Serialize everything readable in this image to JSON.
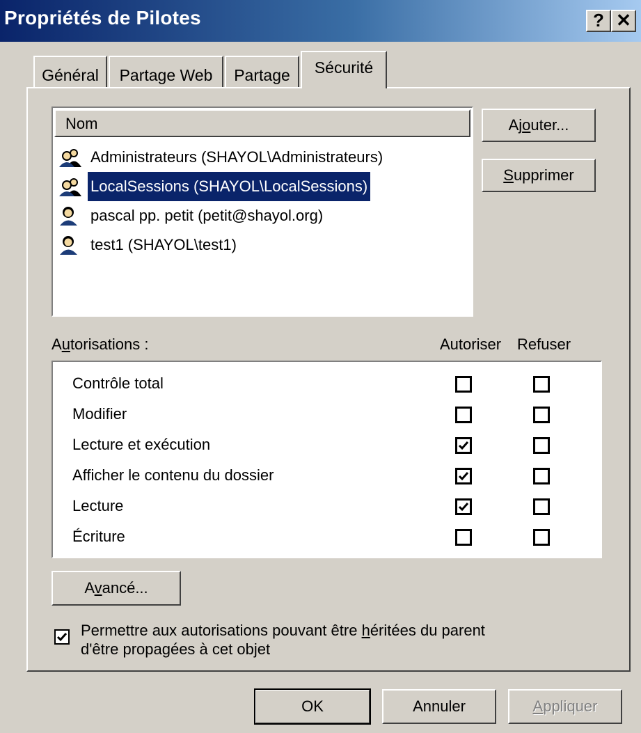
{
  "window": {
    "title": "Propriétés de Pilotes",
    "help_label": "?",
    "close_label": "✕"
  },
  "tabs": [
    {
      "label": "Général",
      "active": false
    },
    {
      "label": "Partage Web",
      "active": false
    },
    {
      "label": "Partage",
      "active": false
    },
    {
      "label": "Sécurité",
      "active": true
    }
  ],
  "users": {
    "column_header": "Nom",
    "items": [
      {
        "label": "Administrateurs (SHAYOL\\Administrateurs)",
        "icon": "group-users-icon",
        "selected": false
      },
      {
        "label": "LocalSessions (SHAYOL\\LocalSessions)",
        "icon": "group-users-icon",
        "selected": true
      },
      {
        "label": "pascal pp. petit (petit@shayol.org)",
        "icon": "user-icon",
        "selected": false
      },
      {
        "label": "test1 (SHAYOL\\test1)",
        "icon": "user-icon",
        "selected": false
      }
    ],
    "add_button": {
      "pre": "Aj",
      "accel": "o",
      "post": "uter..."
    },
    "remove_button": {
      "pre": "",
      "accel": "S",
      "post": "upprimer"
    }
  },
  "permissions": {
    "label": {
      "pre": "A",
      "accel": "u",
      "post": "torisations :"
    },
    "allow_header": "Autoriser",
    "deny_header": "Refuser",
    "rows": [
      {
        "name": "Contrôle total",
        "allow": false,
        "deny": false
      },
      {
        "name": "Modifier",
        "allow": false,
        "deny": false
      },
      {
        "name": "Lecture et exécution",
        "allow": true,
        "deny": false
      },
      {
        "name": "Afficher le contenu du dossier",
        "allow": true,
        "deny": false
      },
      {
        "name": "Lecture",
        "allow": true,
        "deny": false
      },
      {
        "name": "Écriture",
        "allow": false,
        "deny": false
      }
    ]
  },
  "advanced_button": {
    "pre": "A",
    "accel": "v",
    "post": "ancé..."
  },
  "inherit": {
    "checked": true,
    "line1_pre": "Permettre aux autorisations pouvant être ",
    "line1_accel": "h",
    "line1_post": "éritées du parent",
    "line2": "d'être propagées à cet objet"
  },
  "footer": {
    "ok": "OK",
    "cancel": "Annuler",
    "apply": {
      "pre": "",
      "accel": "A",
      "post": "ppliquer",
      "enabled": false
    }
  }
}
